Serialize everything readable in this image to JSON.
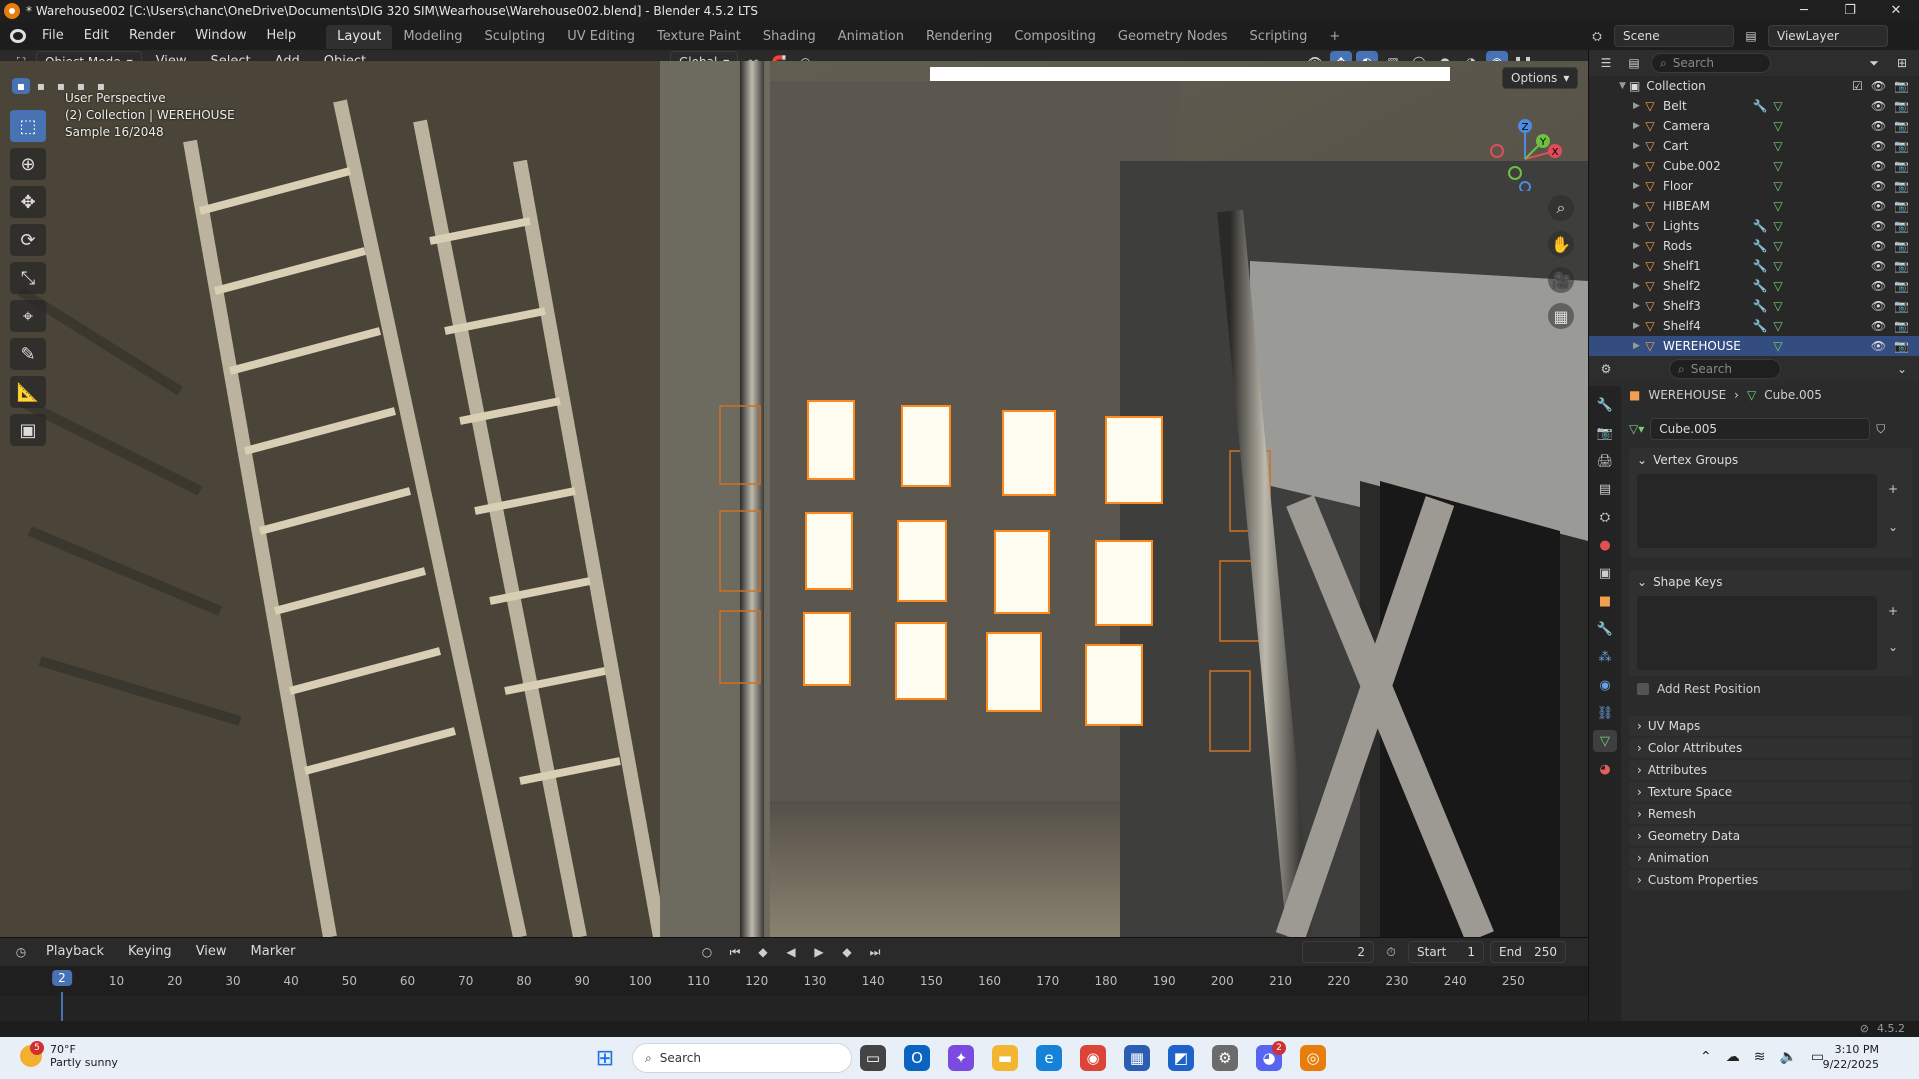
{
  "titlebar": {
    "title": "* Warehouse002 [C:\\Users\\chanc\\OneDrive\\Documents\\DIG 320 SIM\\Wearhouse\\Warehouse002.blend] - Blender 4.5.2 LTS"
  },
  "menu": [
    "File",
    "Edit",
    "Render",
    "Window",
    "Help"
  ],
  "workspaces": [
    "Layout",
    "Modeling",
    "Sculpting",
    "UV Editing",
    "Texture Paint",
    "Shading",
    "Animation",
    "Rendering",
    "Compositing",
    "Geometry Nodes",
    "Scripting"
  ],
  "scene": {
    "label": "Scene",
    "view_layer": "ViewLayer"
  },
  "viewport_header": {
    "mode": "Object Mode",
    "menus": [
      "View",
      "Select",
      "Add",
      "Object"
    ],
    "orientation": "Global",
    "options": "Options"
  },
  "viewport_info": {
    "perspective": "User Perspective",
    "collection": "(2) Collection | WEREHOUSE",
    "sample": "Sample 16/2048"
  },
  "outliner": {
    "search_placeholder": "Search",
    "collection": "Collection",
    "items": [
      {
        "name": "Belt",
        "mod": true,
        "data": true,
        "selected": false
      },
      {
        "name": "Camera",
        "mod": false,
        "data": true,
        "selected": false
      },
      {
        "name": "Cart",
        "mod": false,
        "data": true,
        "selected": false
      },
      {
        "name": "Cube.002",
        "mod": false,
        "data": true,
        "selected": false
      },
      {
        "name": "Floor",
        "mod": false,
        "data": true,
        "selected": false
      },
      {
        "name": "HIBEAM",
        "mod": false,
        "data": true,
        "selected": false
      },
      {
        "name": "Lights",
        "mod": true,
        "data": true,
        "selected": false
      },
      {
        "name": "Rods",
        "mod": true,
        "data": true,
        "selected": false
      },
      {
        "name": "Shelf1",
        "mod": true,
        "data": true,
        "selected": false
      },
      {
        "name": "Shelf2",
        "mod": true,
        "data": true,
        "selected": false
      },
      {
        "name": "Shelf3",
        "mod": true,
        "data": true,
        "selected": false
      },
      {
        "name": "Shelf4",
        "mod": true,
        "data": true,
        "selected": false
      },
      {
        "name": "WEREHOUSE",
        "mod": false,
        "data": true,
        "selected": true
      }
    ]
  },
  "properties": {
    "search_placeholder": "Search",
    "breadcrumb_object": "WEREHOUSE",
    "breadcrumb_data": "Cube.005",
    "mesh_name": "Cube.005",
    "vertex_groups": "Vertex Groups",
    "shape_keys": "Shape Keys",
    "add_rest_position": "Add Rest Position",
    "collapsed_panels": [
      "UV Maps",
      "Color Attributes",
      "Attributes",
      "Texture Space",
      "Remesh",
      "Geometry Data",
      "Animation",
      "Custom Properties"
    ]
  },
  "timeline": {
    "menus": [
      "Playback",
      "Keying",
      "View",
      "Marker"
    ],
    "current_frame": "2",
    "start_label": "Start",
    "start": "1",
    "end_label": "End",
    "end": "250",
    "ticks": [
      "10",
      "20",
      "30",
      "40",
      "50",
      "60",
      "70",
      "80",
      "90",
      "100",
      "110",
      "120",
      "130",
      "140",
      "150",
      "160",
      "170",
      "180",
      "190",
      "200",
      "210",
      "220",
      "230",
      "240",
      "250"
    ],
    "playhead": "2"
  },
  "statusbar": {
    "version": "4.5.2"
  },
  "taskbar": {
    "weather_temp": "70°F",
    "weather_desc": "Partly sunny",
    "weather_badge": "5",
    "search": "Search",
    "time": "3:10 PM",
    "date": "9/22/2025",
    "discord_badge": "2"
  }
}
